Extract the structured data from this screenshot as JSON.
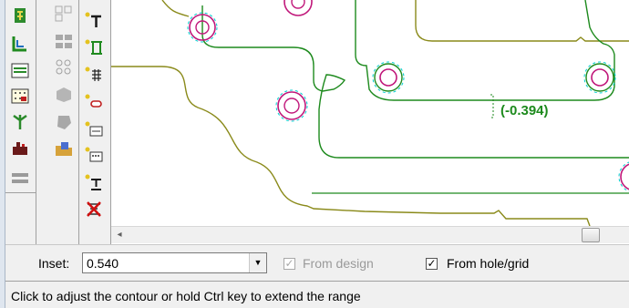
{
  "toolbar": {
    "column1_icons": [
      "spot-tool-icon",
      "edge-tool-icon",
      "layer-tool-icon",
      "grid-tool-icon",
      "branch-tool-icon",
      "outline-tool-icon",
      "frame-tool-icon"
    ],
    "column2_icons": [
      "cluster-tool-icon",
      "group-tool-icon",
      "array-tool-icon",
      "shape-tool-icon",
      "blob-tool-icon",
      "folder-tool-icon"
    ],
    "column3_icons": [
      "text-tool-icon",
      "tab-tool-icon",
      "pins-tool-icon",
      "slot-tool-icon",
      "pad-tool-icon",
      "board-tool-icon",
      "text-anchor-tool-icon",
      "delete-tool-icon"
    ]
  },
  "canvas": {
    "measurement_label": "(-0.394)",
    "colors": {
      "contour": "#1d8a1d",
      "outline": "#8a8a1a",
      "hole": "#c0177a",
      "accent": "#00d0d0"
    }
  },
  "scrollbar": {
    "left_arrow": "◂"
  },
  "options": {
    "inset_label": "Inset:",
    "inset_value": "0.540",
    "dropdown_arrow": "▼",
    "from_design_label": "From design",
    "from_design_checked": true,
    "from_design_enabled": false,
    "from_hole_grid_label": "From hole/grid",
    "from_hole_grid_checked": true,
    "check_mark": "✓"
  },
  "status": {
    "text": "Click to adjust the contour or hold Ctrl key to extend the range"
  }
}
